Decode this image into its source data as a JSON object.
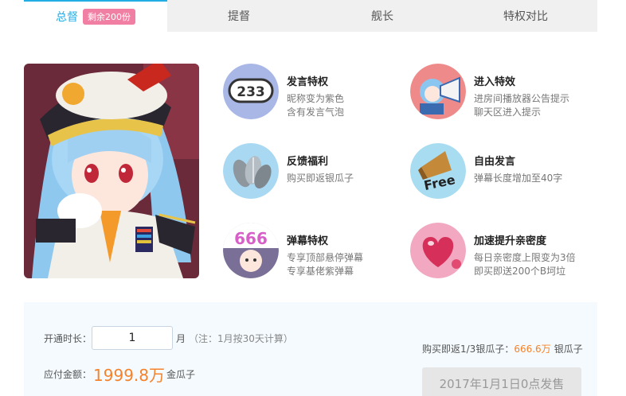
{
  "tabs": [
    {
      "label": "总督",
      "badge": "剩余200份",
      "active": true
    },
    {
      "label": "提督"
    },
    {
      "label": "舰长"
    },
    {
      "label": "特权对比"
    }
  ],
  "features": [
    {
      "title": "发言特权",
      "desc1": "昵称变为紫色",
      "desc2": "含有发言气泡",
      "icon": "chat-bubble-233-icon",
      "icon_text": "233"
    },
    {
      "title": "进入特效",
      "desc1": "进房间播放器公告提示",
      "desc2": "聊天区进入提示",
      "icon": "megaphone-character-icon"
    },
    {
      "title": "反馈福利",
      "desc1": "购买即返银瓜子",
      "desc2": "",
      "icon": "silver-seeds-icon"
    },
    {
      "title": "自由发言",
      "desc1": "弹幕长度增加至40字",
      "desc2": "",
      "icon": "free-megaphone-icon",
      "icon_text": "Free"
    },
    {
      "title": "弹幕特权",
      "desc1": "专享顶部悬停弹幕",
      "desc2": "专享基佬紫弹幕",
      "icon": "danmaku-666-icon",
      "icon_text": "666"
    },
    {
      "title": "加速提升亲密度",
      "desc1": "每日亲密度上限变为3倍",
      "desc2": "即买即送200个B坷垃",
      "icon": "heart-balloon-icon"
    }
  ],
  "purchase": {
    "duration_label": "开通时长：",
    "duration_value": "1",
    "duration_unit": "月",
    "duration_note": "（注：1月按30天计算）",
    "amount_label": "应付金额：",
    "amount_value": "1999.8万",
    "amount_unit": "金瓜子",
    "rebate_prefix": "购买即返1/3银瓜子：",
    "rebate_value": "666.6万",
    "rebate_unit": "银瓜子",
    "sale_button": "2017年1月1日0点发售"
  },
  "colors": {
    "accent": "#23ade5",
    "badge": "#f17fa3",
    "price": "#f6822a",
    "panel": "#f4fafe"
  }
}
